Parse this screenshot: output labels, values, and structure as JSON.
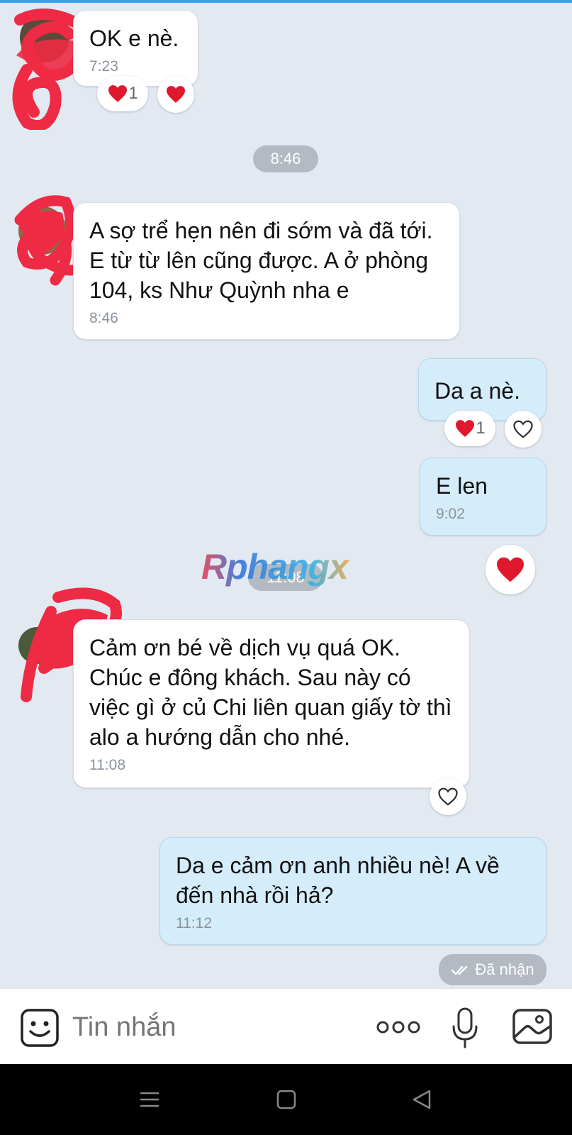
{
  "messages": [
    {
      "text": "OK e nè.",
      "time": "7:23",
      "reaction_count": "1"
    },
    {
      "text": "A sợ trể hẹn nên đi sớm và đã tới. E từ từ lên cũng được. A ở phòng 104, ks Như Quỳnh nha e",
      "time": "8:46"
    },
    {
      "text": "Da a nè.",
      "reaction_count": "1"
    },
    {
      "text": "E len",
      "time": "9:02"
    },
    {
      "text": "Cảm ơn bé về dịch vụ quá OK. Chúc e đông khách. Sau này có việc gì ở củ Chi liên quan giấy tờ thì alo a hướng dẫn cho nhé.",
      "time": "11:08"
    },
    {
      "text": "Da e cảm ơn anh nhiều nè! A về đến nhà rồi hả?",
      "time": "11:12"
    }
  ],
  "separators": [
    "8:46",
    "11:08"
  ],
  "status": {
    "received_label": "Đã nhận"
  },
  "composer": {
    "placeholder": "Tin nhắn"
  },
  "watermark": "Rphangx",
  "colors": {
    "incoming": "#ffffff",
    "outgoing": "#d5ecfb",
    "heart": "#e0182d",
    "scribble": "#ee2a44"
  },
  "icons": [
    "sticker-icon",
    "more-icon",
    "mic-icon",
    "image-icon",
    "heart-icon",
    "menu-icon",
    "home-icon",
    "back-icon"
  ]
}
